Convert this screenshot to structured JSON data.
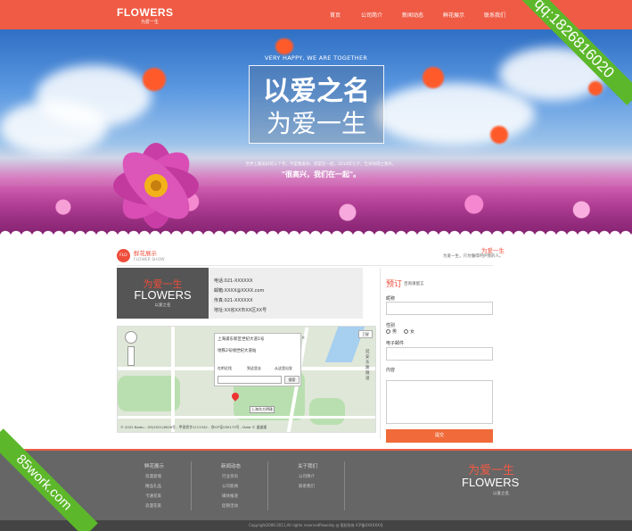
{
  "header": {
    "logo": "FLOWERS",
    "logo_sub": "为爱一生",
    "nav": [
      {
        "label": "首页"
      },
      {
        "label": "公司简介"
      },
      {
        "label": "新闻动态"
      },
      {
        "label": "鲜花展示"
      },
      {
        "label": "联系我们"
      }
    ]
  },
  "watermark": {
    "top_right": "qq:1826816020",
    "bottom_left": "85work.com"
  },
  "hero": {
    "tagline": "VERY HAPPY, WE ARE TOGETHER",
    "line1": "以爱之名",
    "line2": "为爱一生",
    "description": "世界上最美好的三个字，不是我爱你，而是在一起。2014年七夕，告诉你得之我幸。",
    "quote": "\"很高兴，我们在一起\"。"
  },
  "section": {
    "icon_text": "FLO",
    "title": "鲜花展示",
    "subtitle": "FLOWER SHOW",
    "right_title": "为爱一生",
    "right_subtitle": "为爱一生，只为懂得呵护我的人。"
  },
  "contact_card": {
    "cn": "为爱一生",
    "en": "FLOWERS",
    "small": "以爱之名",
    "phone": "电话:021-XXXXXX",
    "email": "邮箱:XXXX@XXXX.com",
    "fax": "传真:021-XXXXXX",
    "address": "地址:XX省XX市XX区XX号"
  },
  "map": {
    "popup_title": "上海浦东新区世纪大道1号",
    "popup_address": "地铁2号线世纪大道站",
    "actions": [
      "在附近找",
      "到这里去",
      "从这里出发"
    ],
    "search_button": "搜索",
    "type_button": "卫星",
    "marker_label": "上海东方明珠",
    "copyright": "© 2022 Baidu - GS(2021)6026号 - 甲测资字1111342 - 京ICP证030173号 - Data © 道道通",
    "vertical_text": "延安东路隧道"
  },
  "form": {
    "title": "预订",
    "title_sub": "咨询请留言",
    "name_label": "昵称",
    "gender_label": "性别",
    "male": "男",
    "female": "女",
    "email_label": "电子邮件",
    "content_label": "内容",
    "submit": "提交"
  },
  "footer": {
    "columns": [
      {
        "title": "鲜花展示",
        "items": [
          "浪漫爱情",
          "精品礼品",
          "卡通花束",
          "浪漫花束"
        ]
      },
      {
        "title": "新闻动态",
        "items": [
          "行业资讯",
          "公司新闻",
          "媒体报道",
          "促销活动"
        ]
      },
      {
        "title": "关于我们",
        "items": [
          "公司简介",
          "联系我们"
        ]
      }
    ],
    "brand_cn": "为爱一生",
    "brand_en": "FLOWERS",
    "brand_small": "以爱之名",
    "copyright": "Copyright2006-2011,All rights reservedPowerby @ 版权所有 ICP备XXXXXX号"
  },
  "colors": {
    "brand_red": "#ef5b45",
    "submit_orange": "#f06a3a",
    "footer_gray": "#666666",
    "ribbon_green": "#5cb82a"
  }
}
